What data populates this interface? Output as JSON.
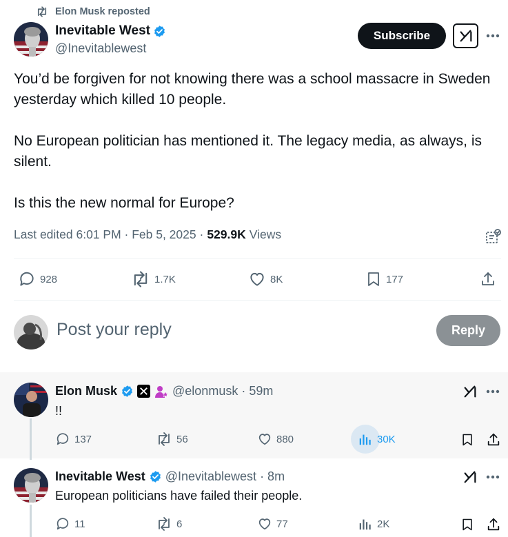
{
  "repost": {
    "label": "Elon Musk reposted",
    "icon": "repost-icon"
  },
  "author": {
    "name": "Inevitable West",
    "handle": "@Inevitablewest",
    "verified": true
  },
  "header_actions": {
    "subscribe_label": "Subscribe",
    "grok_icon": "grok-icon",
    "more_icon": "more-icon"
  },
  "tweet": {
    "paragraphs": [
      "You’d be forgiven for not knowing there was a school massacre in Sweden yesterday which killed 10 people.",
      "No European politician has mentioned it. The legacy media, as always, is silent.",
      "Is this the new normal for Europe?"
    ],
    "meta_prefix": "Last edited 6:01 PM · Feb 5, 2025 ·",
    "views_count": "529.9K",
    "views_label": "Views"
  },
  "actions": {
    "replies": "928",
    "reposts": "1.7K",
    "likes": "8K",
    "bookmarks": "177"
  },
  "composer": {
    "placeholder": "Post your reply",
    "reply_label": "Reply"
  },
  "replies": [
    {
      "name": "Elon Musk",
      "handle": "@elonmusk",
      "time": "· 59m",
      "text": "!!",
      "stats": {
        "replies": "137",
        "reposts": "56",
        "likes": "880",
        "views": "30K"
      }
    },
    {
      "name": "Inevitable West",
      "handle": "@Inevitablewest",
      "time": "· 8m",
      "text": "European politicians have failed their people.",
      "stats": {
        "replies": "11",
        "reposts": "6",
        "likes": "77",
        "views": "2K"
      }
    }
  ],
  "colors": {
    "verified": "#1d9bf0",
    "text": "#0f1419",
    "muted": "#536471",
    "views_highlight": "#1d9bf0",
    "reply_button": "#8b9195",
    "thread_highlight_bg": "#f7f7f7"
  }
}
